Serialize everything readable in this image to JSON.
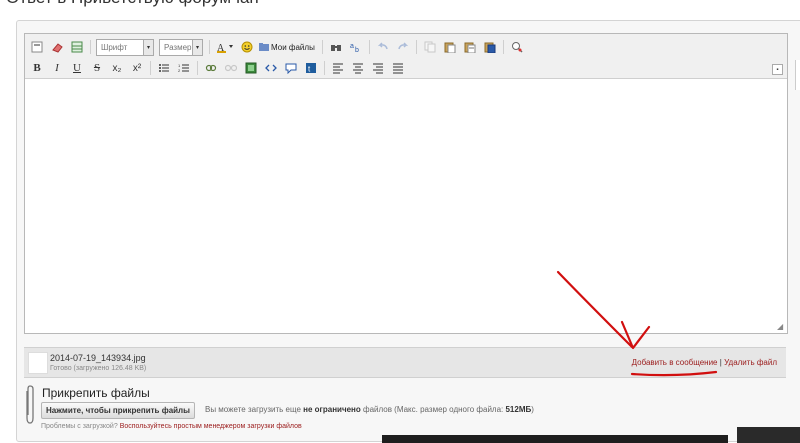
{
  "page": {
    "title": "Ответ в Приветствую форумчан"
  },
  "toolbar": {
    "font_combo": "Шрифт",
    "size_combo": "Размер",
    "my_files": "Мои файлы",
    "row1_icons": [
      "source-icon",
      "eraser-icon",
      "table-icon"
    ],
    "row1_icons_b": [
      "text-color-icon",
      "smiley-icon",
      "folder-icon"
    ],
    "row1_icons_c": [
      "find-icon",
      "replace-icon",
      "undo-icon",
      "redo-icon",
      "copy-icon",
      "paste-icon",
      "paste-text-icon",
      "paste-word-icon",
      "spellcheck-icon"
    ],
    "row2": [
      {
        "name": "bold-button",
        "label": "B"
      },
      {
        "name": "italic-button",
        "label": "I"
      },
      {
        "name": "underline-button",
        "label": "U"
      },
      {
        "name": "strike-button",
        "label": "S"
      },
      {
        "name": "subscript-button",
        "label": "x₂"
      },
      {
        "name": "superscript-button",
        "label": "x²"
      }
    ]
  },
  "attachment": {
    "file_name": "2014-07-19_143934.jpg",
    "status": "Готово (загружено 126.48 KB)",
    "add_to_message": "Добавить в сообщение",
    "separator": "|",
    "delete_file": "Удалить файл"
  },
  "attach_section": {
    "title": "Прикрепить файлы",
    "button": "Нажмите, чтобы прикрепить файлы",
    "info_prefix": "Вы можете загрузить еще ",
    "info_bold": "не ограничено",
    "info_mid": " файлов (Макс. размер одного файла: ",
    "info_size": "512МБ",
    "info_suffix": ")",
    "problems_prefix": "Проблемы с загрузкой? ",
    "problems_link": "Воспользуйтесь простым менеджером загрузки файлов"
  },
  "colors": {
    "link": "#9b1c1c",
    "annotation": "#d10f0f",
    "toolbar_bg": "#f0f0f0"
  }
}
